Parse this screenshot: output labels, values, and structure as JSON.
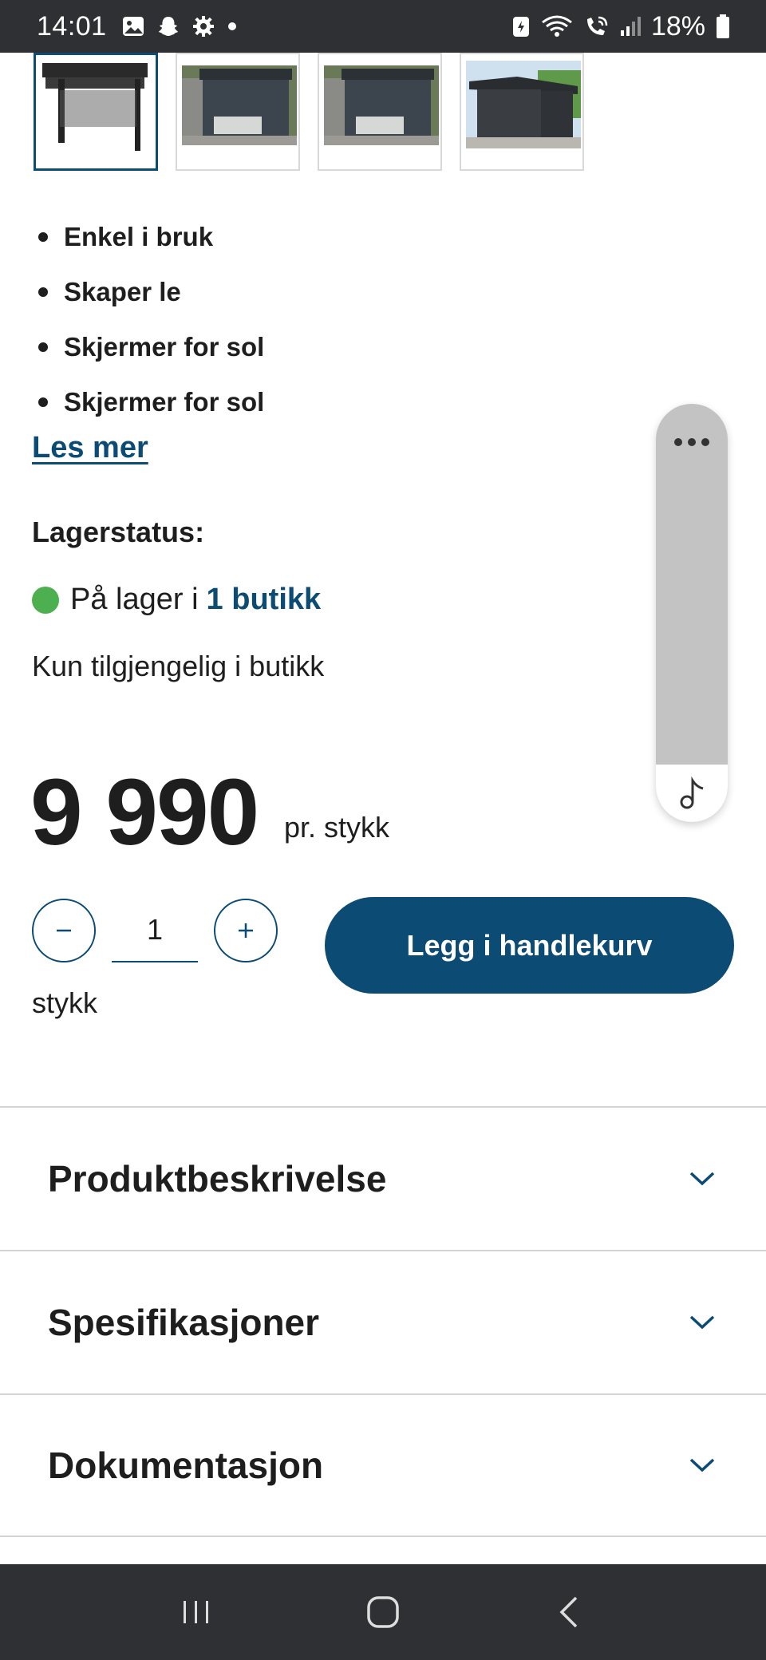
{
  "status_bar": {
    "time": "14:01",
    "battery_percent": "18%",
    "left_icons": [
      "gallery-icon",
      "snapchat-icon",
      "settings-icon",
      "dot-icon"
    ],
    "right_icons": [
      "battery-saver-icon",
      "wifi-icon",
      "wifi-calling-icon",
      "signal-icon",
      "battery-icon"
    ]
  },
  "thumbnails": [
    {
      "name": "pergola-product-photo",
      "selected": true
    },
    {
      "name": "pergola-patio-photo-1",
      "selected": false
    },
    {
      "name": "pergola-patio-photo-2",
      "selected": false
    },
    {
      "name": "pergola-garden-photo",
      "selected": false
    }
  ],
  "features": [
    "Enkel i bruk",
    "Skaper le",
    "Skjermer for sol",
    "Skjermer for sol"
  ],
  "read_more_label": "Les mer",
  "stock": {
    "title": "Lagerstatus:",
    "prefix": "På lager i",
    "link": "1 butikk",
    "status_color": "#4caf50",
    "availability": "Kun tilgjengelig i butikk"
  },
  "price": {
    "amount": "9 990",
    "unit": "pr. stykk"
  },
  "quantity": {
    "value": "1",
    "unit": "stykk"
  },
  "add_to_cart_label": "Legg i handlekurv",
  "accordion": [
    {
      "title": "Produktbeskrivelse"
    },
    {
      "title": "Spesifikasjoner"
    },
    {
      "title": "Dokumentasjon"
    }
  ],
  "colors": {
    "accent": "#0b4b74",
    "system_bar": "#2f3033"
  }
}
